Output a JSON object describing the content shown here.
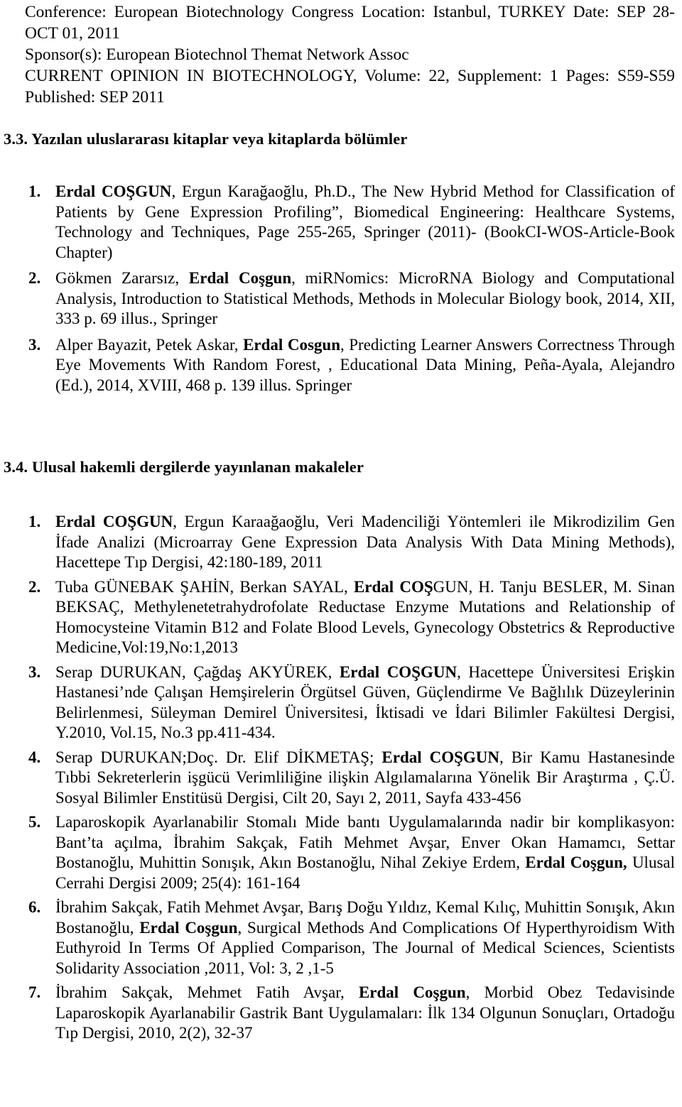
{
  "document": {
    "header": {
      "lines": [
        "Conference: European Biotechnology Congress Location: Istanbul, TURKEY Date: SEP 28-OCT 01, 2011",
        "Sponsor(s): European Biotechnol Themat Network Assoc",
        "CURRENT OPINION IN BIOTECHNOLOGY, Volume: 22, Supplement: 1   Pages: S59-S59   Published: SEP 2011"
      ]
    },
    "sections": [
      {
        "number": "3.3.",
        "title": "Yazılan uluslararası kitaplar veya kitaplarda bölümler",
        "heading_full": "3.3. Yazılan uluslararası kitaplar veya kitaplarda bölümler",
        "items": [
          {
            "num": "1.",
            "bold_lead": "Erdal COŞGUN",
            "rest": ", Ergun Karağaoğlu, Ph.D., The New Hybrid Method for Classification of Patients by Gene Expression Profiling”, Biomedical Engineering: Healthcare Systems, Technology and Techniques, Page 255-265, Springer (2011)- (BookCI-WOS-Article-Book Chapter)"
          },
          {
            "num": "2.",
            "prefix": "Gökmen Zararsız, ",
            "bold_lead": "Erdal Coşgun",
            "rest": ", miRNomics: MicroRNA Biology and Computational Analysis, Introduction to Statistical Methods, Methods in Molecular Biology book, 2014, XII, 333 p. 69 illus., Springer"
          },
          {
            "num": "3.",
            "prefix": "Alper Bayazit, Petek Askar, ",
            "bold_lead": "Erdal Cosgun",
            "rest": ", Predicting Learner Answers Correctness Through Eye Movements With Random Forest, , Educational Data Mining, Peña-Ayala, Alejandro (Ed.), 2014, XVIII, 468 p. 139 illus. Springer"
          }
        ]
      },
      {
        "number": "3.4.",
        "title": "Ulusal hakemli dergilerde yayınlanan makaleler",
        "heading_full": "3.4. Ulusal hakemli dergilerde yayınlanan makaleler",
        "items": [
          {
            "num": "1.",
            "prefix": "",
            "bold_lead": "Erdal COŞGUN",
            "rest": ", Ergun Karaağaoğlu, Veri Madenciliği Yöntemleri ile Mikrodizilim Gen İfade Analizi (Microarray Gene Expression Data Analysis With Data Mining Methods), Hacettepe Tıp Dergisi, 42:180-189, 2011"
          },
          {
            "num": "2.",
            "prefix": "Tuba GÜNEBAK ŞAHİN, Berkan SAYAL, ",
            "bold_lead": "Erdal COŞ",
            "rest": "GUN, H. Tanju BESLER, M. Sinan BEKSAÇ, Methylenetetrahydrofolate Reductase Enzyme Mutations and Relationship of Homocysteine Vitamin B12 and Folate Blood Levels, Gynecology Obstetrics & Reproductive Medicine,Vol:19,No:1,2013"
          },
          {
            "num": "3.",
            "prefix": "Serap DURUKAN, Çağdaş AKYÜREK, ",
            "bold_lead": "Erdal COŞGUN",
            "rest": ", Hacettepe Üniversitesi Erişkin Hastanesi’nde Çalışan Hemşirelerin Örgütsel Güven, Güçlendirme Ve Bağlılık Düzeylerinin Belirlenmesi, Süleyman Demirel Üniversitesi, İktisadi ve İdari Bilimler Fakültesi Dergisi, Y.2010, Vol.15, No.3 pp.411-434."
          },
          {
            "num": "4.",
            "prefix": "Serap DURUKAN;Doç. Dr. Elif DİKMETAŞ; ",
            "bold_lead": "Erdal COŞGUN",
            "rest": ", Bir Kamu Hastanesinde Tıbbi Sekreterlerin işgücü Verimliliğine ilişkin Algılamalarına Yönelik Bir Araştırma , Ç.Ü. Sosyal Bilimler Enstitüsü Dergisi, Cilt 20, Sayı 2, 2011, Sayfa 433-456"
          },
          {
            "num": "5.",
            "prefix": "Laparoskopik Ayarlanabilir Stomalı Mide bantı Uygulamalarında nadir bir komplikasyon: Bant’ta açılma, İbrahim Sakçak, Fatih Mehmet Avşar, Enver Okan Hamamcı, Settar Bostanoğlu, Muhittin Sonışık, Akın Bostanoğlu, Nihal Zekiye Erdem, ",
            "bold_lead": "Erdal Coşgun,",
            "rest": " Ulusal Cerrahi Dergisi 2009; 25(4): 161-164"
          },
          {
            "num": "6.",
            "prefix": "İbrahim Sakçak, Fatih Mehmet Avşar, Barış Doğu Yıldız, Kemal Kılıç, Muhittin Sonışık, Akın Bostanoğlu, ",
            "bold_lead": "Erdal Coşgun",
            "rest": ", Surgical Methods And Complications Of Hyperthyroidism With Euthyroid In Terms Of Applied Comparison, The Journal of Medical Sciences, Scientists Solidarity Association ,2011, Vol: 3,  2 ,1-5"
          },
          {
            "num": "7.",
            "prefix": "İbrahim Sakçak, Mehmet Fatih Avşar, ",
            "bold_lead": "Erdal Coşgun",
            "rest": ", Morbid Obez Tedavisinde Laparoskopik Ayarlanabilir Gastrik Bant Uygulamaları: İlk 134 Olgunun Sonuçları, Ortadoğu Tıp Dergisi, 2010, 2(2), 32-37"
          }
        ]
      }
    ]
  }
}
